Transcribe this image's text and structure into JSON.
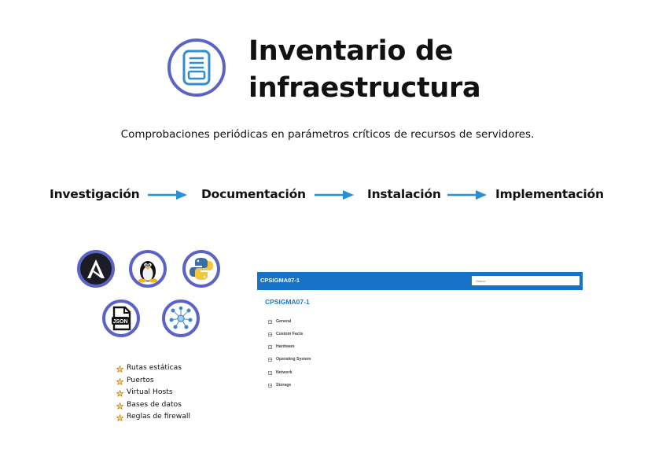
{
  "header": {
    "title_line1": "Inventario de",
    "title_line2": "infraestructura",
    "subtitle": "Comprobaciones periódicas en parámetros críticos de recursos de servidores.",
    "logo_icon": "document-list-icon"
  },
  "flow": {
    "steps": [
      "Investigación",
      "Documentación",
      "Instalación",
      "Implementación"
    ],
    "arrow_icon": "right-arrow-icon"
  },
  "tools": {
    "icons": [
      "ansible-icon",
      "linux-tux-icon",
      "python-icon",
      "json-file-icon",
      "network-nodes-icon"
    ],
    "json_label": "JSON"
  },
  "bullets": {
    "items": [
      "Rutas estáticas",
      "Puertos",
      "Virtual Hosts",
      "Bases de datos",
      "Reglas de firewall"
    ],
    "marker_icon": "star-icon"
  },
  "app": {
    "bar_title": "CPSIGMA07-1",
    "search_placeholder": "Search",
    "host_title": "CPSIGMA07-1",
    "sections": [
      "General",
      "Custom Facts",
      "Hardware",
      "Operating System",
      "Network",
      "Storage"
    ]
  },
  "colors": {
    "accent": "#5b63c4",
    "logo_blue": "#2f8fd0",
    "arrow_blue": "#2d8fd3",
    "app_bar": "#1773c8",
    "host_title": "#1a7ad1",
    "star": "#e0a21a",
    "python_blue": "#3a6fa4",
    "python_yellow": "#f2c63d"
  }
}
